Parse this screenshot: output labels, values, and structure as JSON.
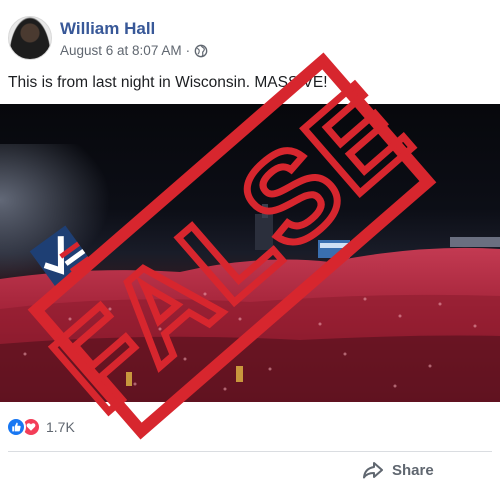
{
  "post": {
    "author": "William Hall",
    "date": "August 6 at 8:07 AM",
    "separator": "·",
    "privacy_icon": "globe-icon",
    "text": "This is from last night in Wisconsin. MASSIVE!"
  },
  "photo": {
    "sign_text": "",
    "stamp_text": "FALSE",
    "stamp_color": "#d7262e",
    "logo_icon": "checkmark-flag-logo"
  },
  "reactions": {
    "icons": [
      "like-icon",
      "love-icon"
    ],
    "count": "1.7K"
  },
  "actions": {
    "share_label": "Share"
  },
  "colors": {
    "author_link": "#385898",
    "meta_text": "#606770",
    "like_blue": "#1877f2",
    "love_red": "#f33e58"
  }
}
